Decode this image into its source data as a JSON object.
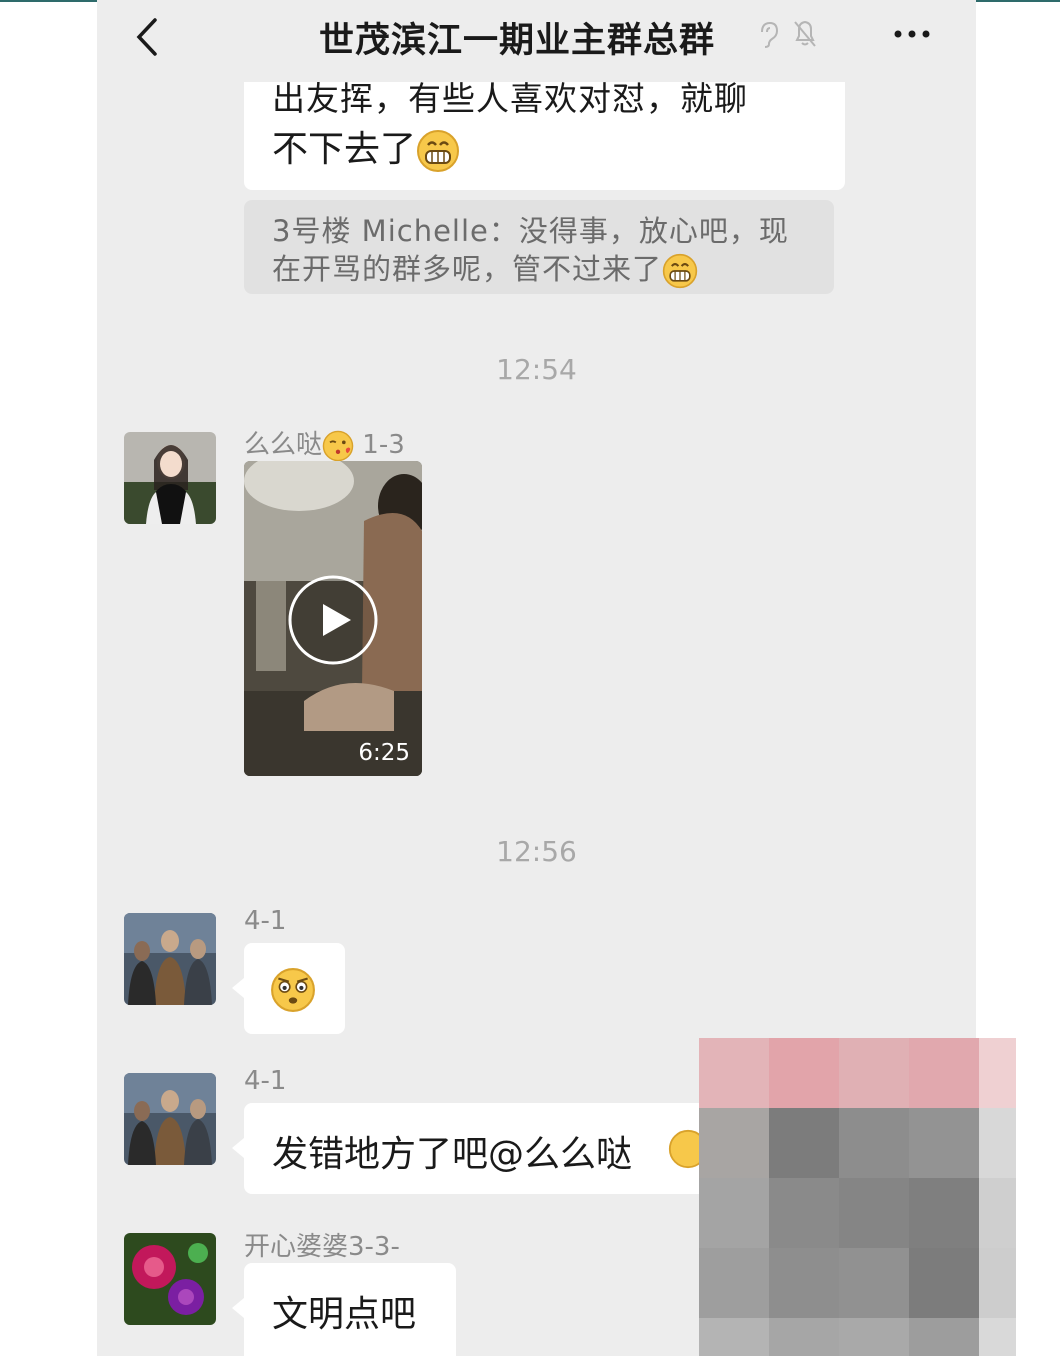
{
  "header": {
    "title": "世茂滨江一期业主群总群",
    "back_icon": "chevron-left-icon",
    "ear_icon": "ear-icon",
    "mute_icon": "bell-muted-icon",
    "more_icon": "more-icon"
  },
  "messages": {
    "first": {
      "line1": "出友挥，有些人喜欢对怼，就聊",
      "line2": "不下去了"
    },
    "quote": {
      "line1": "3号楼 Michelle：没得事，放心吧，现",
      "line2": "在开骂的群多呢，管不过来了"
    },
    "time1": "12:54",
    "video_msg": {
      "sender": "么么哒",
      "sender_suffix": "1-3",
      "duration": "6:25"
    },
    "time2": "12:56",
    "emoji_msg": {
      "sender": "4-1"
    },
    "text_msg": {
      "sender": "4-1",
      "text": "发错地方了吧@么么哒"
    },
    "last_msg": {
      "sender": "开心婆婆3-3-",
      "text": "文明点吧"
    }
  },
  "colors": {
    "chat_bg": "#ededed",
    "bubble": "#ffffff",
    "quote_bg": "#e1e1e1",
    "time_text": "#a8a8a8"
  }
}
